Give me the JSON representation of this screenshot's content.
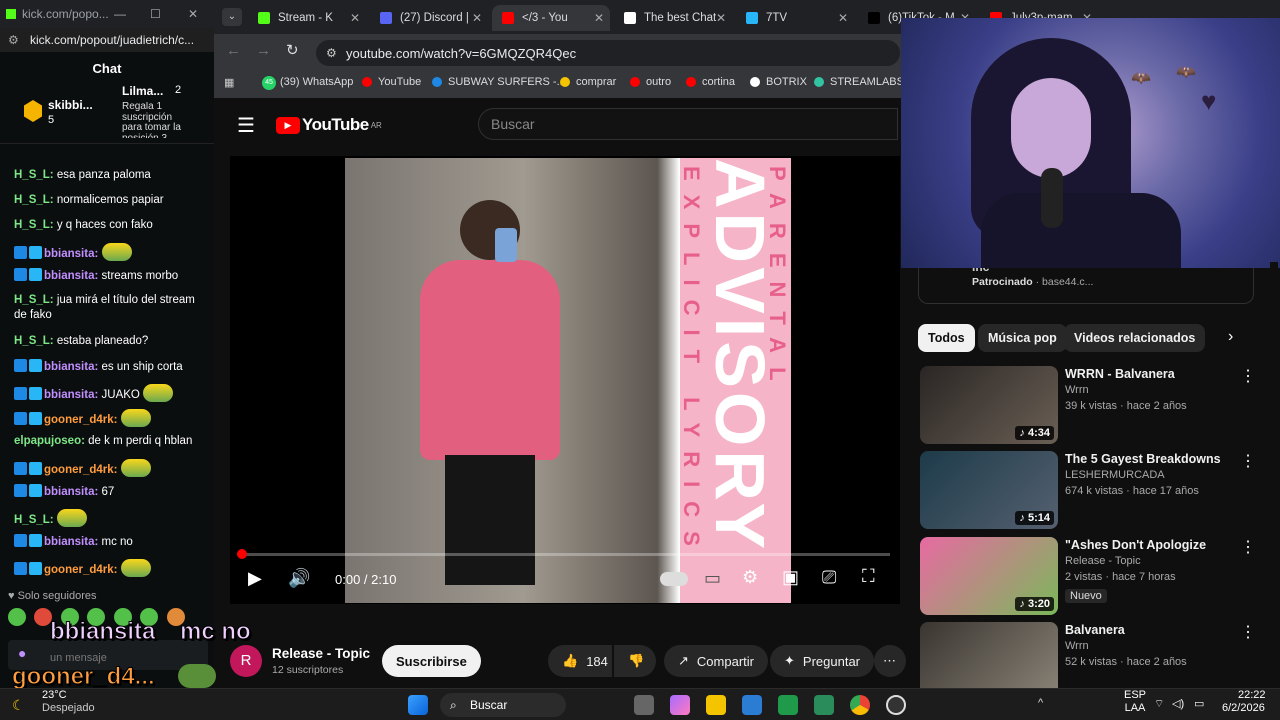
{
  "kick": {
    "title": "kick.com/popo...",
    "url": "kick.com/popout/juadietrich/c...",
    "chat_title": "Chat",
    "pinned": {
      "user": "skibbi...",
      "count": "5",
      "user2": "Lilma...",
      "count2": "2",
      "gift_text": "Regala 1 suscripción para tomar la posición 3"
    },
    "messages": [
      {
        "user": "H_S_L:",
        "text": "esa panza paloma",
        "color": "green",
        "badge": false,
        "emote": false
      },
      {
        "user": "H_S_L:",
        "text": "normalicemos papiar",
        "color": "green",
        "badge": false,
        "emote": false
      },
      {
        "user": "H_S_L:",
        "text": "y q haces con fako",
        "color": "green",
        "badge": false,
        "emote": false
      },
      {
        "user": "bbiansita:",
        "text": "",
        "color": "purple",
        "badge": true,
        "emote": true
      },
      {
        "user": "bbiansita:",
        "text": "streams morbo",
        "color": "purple",
        "badge": true,
        "emote": false
      },
      {
        "user": "H_S_L:",
        "text": "jua mirá el título del stream de fako",
        "color": "green",
        "badge": false,
        "emote": false
      },
      {
        "user": "H_S_L:",
        "text": "estaba planeado?",
        "color": "green",
        "badge": false,
        "emote": false
      },
      {
        "user": "bbiansita:",
        "text": "es un ship corta",
        "color": "purple",
        "badge": true,
        "emote": false
      },
      {
        "user": "bbiansita:",
        "text": "JUAKO",
        "color": "purple",
        "badge": true,
        "emote": true
      },
      {
        "user": "gooner_d4rk:",
        "text": "",
        "color": "orange",
        "badge": true,
        "emote": true
      },
      {
        "user": "elpapujoseo:",
        "text": "de k m perdi q hblan",
        "color": "green",
        "badge": false,
        "emote": false
      },
      {
        "user": "gooner_d4rk:",
        "text": "",
        "color": "orange",
        "badge": true,
        "emote": true
      },
      {
        "user": "bbiansita:",
        "text": "67",
        "color": "purple",
        "badge": true,
        "emote": false
      },
      {
        "user": "H_S_L:",
        "text": "",
        "color": "green",
        "badge": false,
        "emote": true
      },
      {
        "user": "bbiansita:",
        "text": "mc no",
        "color": "purple",
        "badge": true,
        "emote": false
      },
      {
        "user": "gooner_d4rk:",
        "text": "",
        "color": "orange",
        "badge": true,
        "emote": true
      }
    ],
    "followers_only": "Solo seguidores",
    "input_placeholder": "un mensaje"
  },
  "tabs": [
    {
      "label": "Stream - K",
      "color": "#53fc18"
    },
    {
      "label": "(27) Discord |",
      "color": "#5865f2"
    },
    {
      "label": "</3 - You",
      "color": "#ff0000"
    },
    {
      "label": "The best Chat",
      "color": "#ffffff"
    },
    {
      "label": "7TV",
      "color": "#29b6f6"
    },
    {
      "label": "(6)TikTok - M",
      "color": "#000000"
    },
    {
      "label": "July3p-mam",
      "color": "#ff0000"
    }
  ],
  "address": "youtube.com/watch?v=6GMQZQR4Qec",
  "bookmarks": [
    "(39) WhatsApp",
    "YouTube",
    "SUBWAY SURFERS -...",
    "comprar",
    "outro",
    "cortina",
    "BOTRIX",
    "STREAMLABS"
  ],
  "whatsapp_badge": "45",
  "yt": {
    "logo": "YouTube",
    "region": "AR",
    "search_placeholder": "Buscar",
    "time": "0:00 / 2:10",
    "advisory_big": "ADVISORY",
    "advisory_top": "PARENTAL",
    "advisory_side": "EXPLICIT LYRICS",
    "channel_initial": "R",
    "channel_name": "Release - Topic",
    "subscribers": "12 suscriptores",
    "subscribe": "Suscribirse",
    "likes": "184",
    "share": "Compartir",
    "ask": "Preguntar",
    "sponsored_title": "Inc",
    "sponsored_label": "Patrocinado",
    "sponsored_domain": "base44.c...",
    "chips": [
      "Todos",
      "Música pop",
      "Videos relacionados"
    ],
    "related": [
      {
        "title": "WRRN - Balvanera",
        "channel": "Wrrn",
        "meta": "39 k vistas · hace 2 años",
        "duration": "4:34",
        "badge": ""
      },
      {
        "title": "The 5 Gayest Breakdowns",
        "channel": "LESHERMURCADA",
        "meta": "674 k vistas · hace 17 años",
        "duration": "5:14",
        "badge": ""
      },
      {
        "title": "\"Ashes Don't Apologize",
        "channel": "Release - Topic",
        "meta": "2 vistas · hace 7 horas",
        "duration": "3:20",
        "badge": "Nuevo"
      },
      {
        "title": "Balvanera",
        "channel": "Wrrn",
        "meta": "52 k vistas · hace 2 años",
        "duration": "",
        "badge": ""
      }
    ]
  },
  "overlay": {
    "line1_user": "bbiansita",
    "line1_msg": "mc no",
    "line2_user": "gooner_d4..."
  },
  "taskbar": {
    "weather_temp": "23°C",
    "weather_desc": "Despejado",
    "search": "Buscar",
    "lang1": "ESP",
    "lang2": "LAA",
    "time": "22:22",
    "date": "6/2/2026"
  }
}
